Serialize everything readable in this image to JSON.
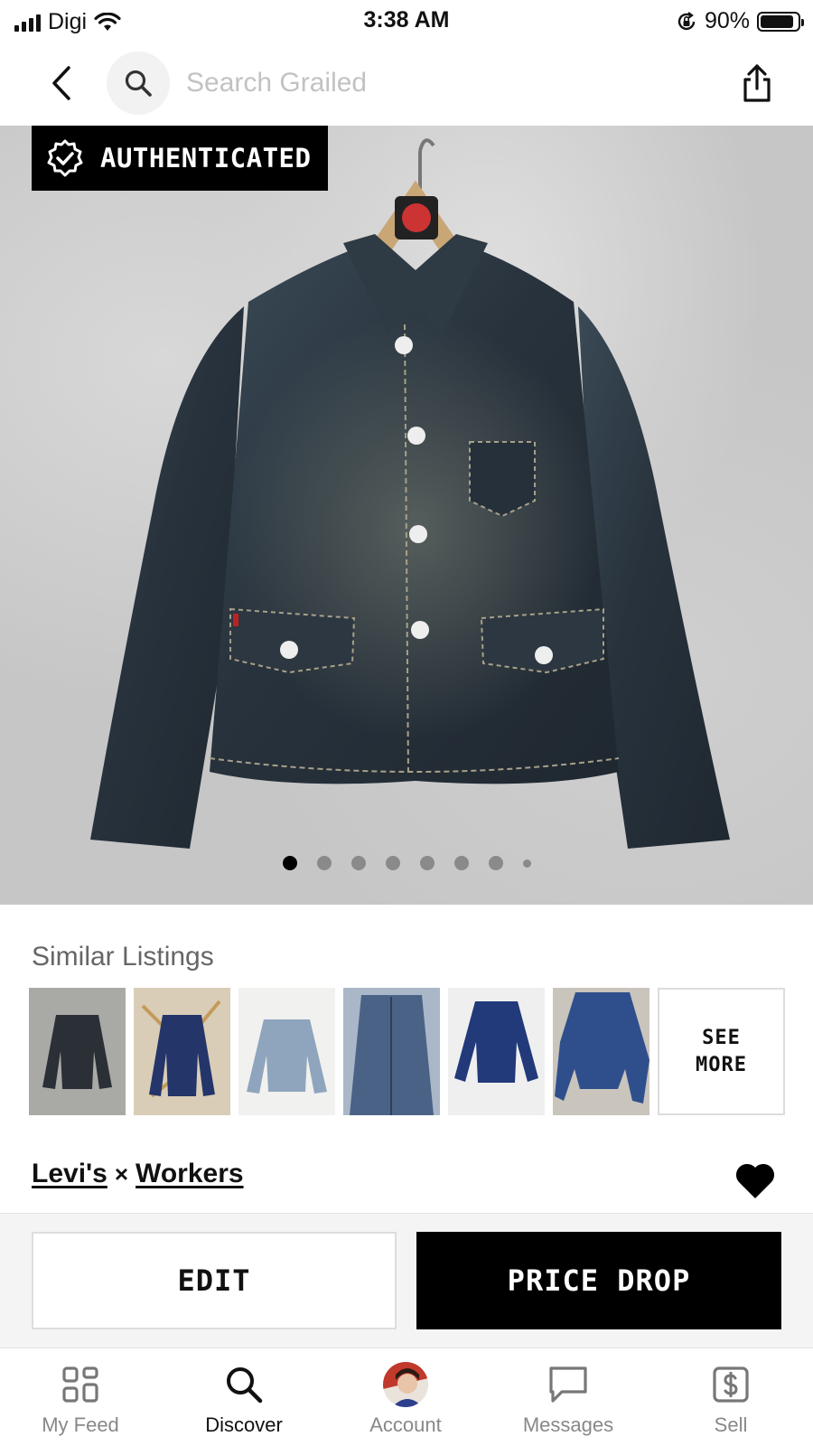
{
  "status_bar": {
    "carrier": "Digi",
    "time": "3:38 AM",
    "battery": "90%",
    "battery_level": 0.9
  },
  "nav": {
    "search_placeholder": "Search Grailed",
    "icons": {
      "back": "chevron-left-icon",
      "search": "search-icon",
      "share": "share-icon"
    }
  },
  "listing": {
    "badge": "AUTHENTICATED",
    "image_count": 8,
    "active_image": 1,
    "brands": [
      "Levi's",
      "Workers"
    ],
    "brand_separator": "×",
    "favorited": true
  },
  "similar": {
    "title": "Similar Listings",
    "see_more": "SEE\nMORE",
    "count": 6
  },
  "actions": {
    "edit": "EDIT",
    "price_drop": "PRICE DROP"
  },
  "tabs": [
    {
      "label": "My Feed",
      "icon": "feed-grid-icon"
    },
    {
      "label": "Discover",
      "icon": "search-icon"
    },
    {
      "label": "Account",
      "icon": "avatar"
    },
    {
      "label": "Messages",
      "icon": "chat-bubble-icon"
    },
    {
      "label": "Sell",
      "icon": "dollar-tag-icon"
    }
  ],
  "active_tab": "Discover",
  "colors": {
    "accent": "#000000",
    "muted": "#888888",
    "background": "#ffffff"
  }
}
